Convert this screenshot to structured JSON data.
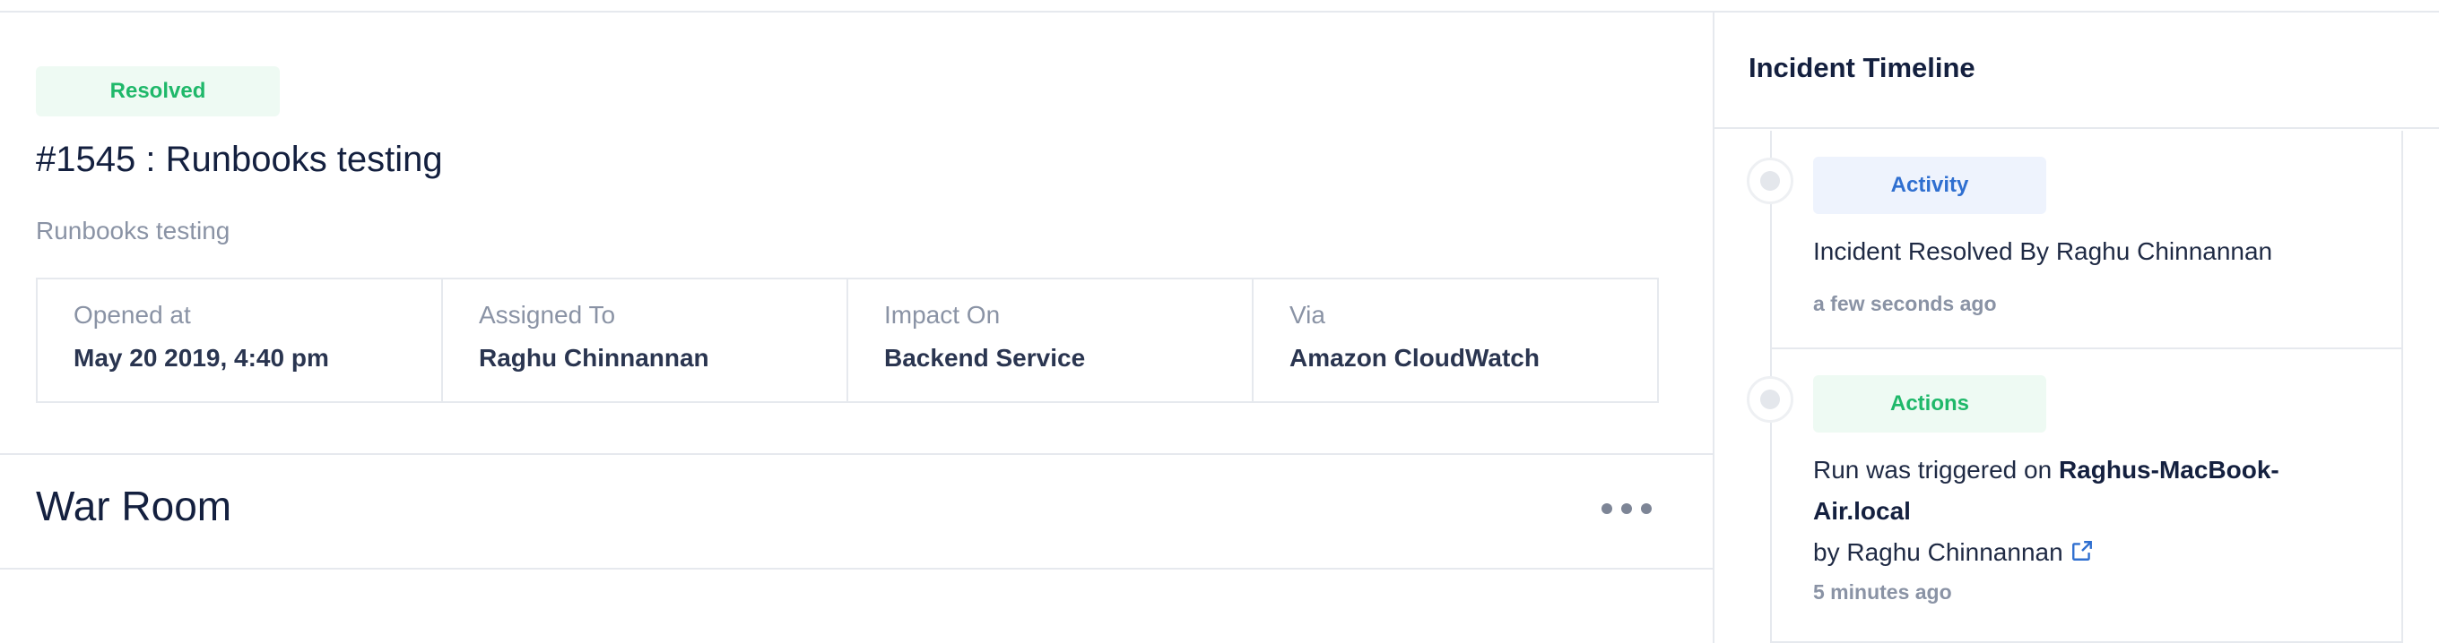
{
  "incident": {
    "status": "Resolved",
    "title": "#1545 : Runbooks testing",
    "description": "Runbooks testing",
    "fields": [
      {
        "label": "Opened at",
        "value": "May 20 2019, 4:40 pm"
      },
      {
        "label": "Assigned To",
        "value": "Raghu Chinnannan"
      },
      {
        "label": "Impact On",
        "value": "Backend Service"
      },
      {
        "label": "Via",
        "value": "Amazon CloudWatch"
      }
    ]
  },
  "war_room": {
    "title": "War Room",
    "more_icon": "more-horizontal-icon"
  },
  "timeline": {
    "title": "Incident Timeline",
    "entries": [
      {
        "type": "Activity",
        "text": "Incident Resolved By Raghu Chinnannan",
        "time": "a few seconds ago"
      },
      {
        "type": "Actions",
        "text_prefix": "Run was triggered on ",
        "host_line1": "Raghus-MacBook-",
        "host_line2": "Air.local",
        "text_by": "by Raghu Chinnannan",
        "link_icon": "external-link-icon",
        "time": "5 minutes ago"
      }
    ]
  },
  "colors": {
    "resolved_green": "#1fb86a",
    "activity_blue": "#2f6fd0",
    "heading_navy": "#14203f",
    "muted_gray": "#8a93a5"
  }
}
